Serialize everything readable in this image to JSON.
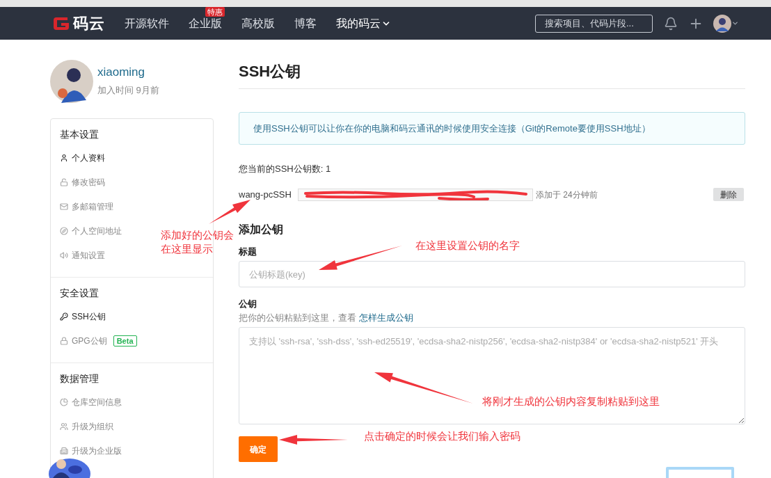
{
  "nav": {
    "logo_text": "码云",
    "items": [
      {
        "label": "开源软件",
        "selected": false
      },
      {
        "label": "企业版",
        "selected": false,
        "badge": "特惠"
      },
      {
        "label": "高校版",
        "selected": false
      },
      {
        "label": "博客",
        "selected": false
      },
      {
        "label": "我的码云",
        "selected": true,
        "dropdown": true
      }
    ],
    "search": {
      "placeholder": "搜索项目、代码片段..."
    }
  },
  "profile": {
    "username": "xiaoming",
    "joined": "加入时间 9月前"
  },
  "sidebar": {
    "groups": [
      {
        "title": "基本设置",
        "items": [
          {
            "label": "个人资料",
            "selected": true
          },
          {
            "label": "修改密码",
            "selected": false
          },
          {
            "label": "多邮箱管理",
            "selected": false
          },
          {
            "label": "个人空间地址",
            "selected": false
          },
          {
            "label": "通知设置",
            "selected": false
          }
        ]
      },
      {
        "title": "安全设置",
        "items": [
          {
            "label": "SSH公钥",
            "selected": true
          },
          {
            "label": "GPG公钥",
            "selected": false,
            "badge": "Beta"
          }
        ]
      },
      {
        "title": "数据管理",
        "items": [
          {
            "label": "仓库空间信息",
            "selected": false
          },
          {
            "label": "升级为组织",
            "selected": false
          },
          {
            "label": "升级为企业版",
            "selected": false
          }
        ]
      }
    ]
  },
  "main": {
    "title": "SSH公钥",
    "notice": "使用SSH公钥可以让你在你的电脑和码云通讯的时候使用安全连接（Git的Remote要使用SSH地址）",
    "key_count": "您当前的SSH公钥数: 1",
    "keys": [
      {
        "name": "wang-pcSSH",
        "added": "添加于 24分钟前",
        "delete_button": "删除"
      }
    ],
    "add_title": "添加公钥",
    "title_label": "标题",
    "title_placeholder": "公钥标题(key)",
    "key_label": "公钥",
    "key_hint": "把你的公钥粘贴到这里，查看",
    "key_hint_link": "怎样生成公钥",
    "key_placeholder": "支持以 'ssh-rsa', 'ssh-dss', 'ssh-ed25519', 'ecdsa-sha2-nistp256', 'ecdsa-sha2-nistp384' or 'ecdsa-sha2-nistp521' 开头",
    "submit": "确定"
  },
  "annotations": [
    {
      "text": "添加好的公钥会"
    },
    {
      "text": "在这里显示"
    },
    {
      "text": "在这里设置公钥的名字"
    },
    {
      "text": "将刚才生成的公钥内容复制粘贴到这里"
    },
    {
      "text": "点击确定的时候会让我们输入密码"
    }
  ]
}
